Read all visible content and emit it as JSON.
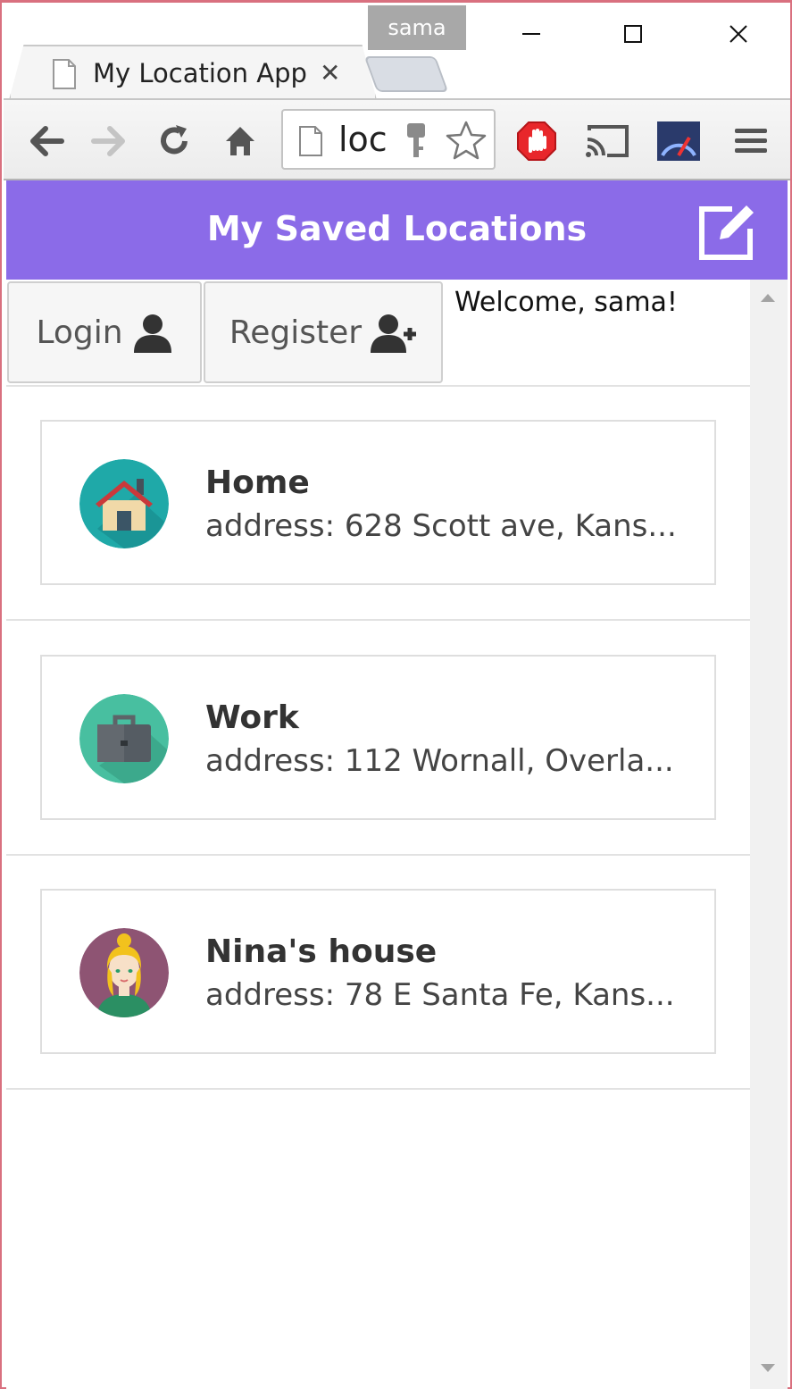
{
  "browser": {
    "profile_name": "sama",
    "tab_title": "My Location App",
    "tab_close": "✕",
    "omnibox_text": "loca"
  },
  "app": {
    "title": "My Saved Locations",
    "header_color": "#8b6be8"
  },
  "auth": {
    "login_label": "Login",
    "register_label": "Register",
    "welcome_text": "Welcome, sama!"
  },
  "locations": [
    {
      "name": "Home",
      "address": "address: 628 Scott ave, Kans...",
      "icon": "house-icon"
    },
    {
      "name": "Work",
      "address": "address: 112 Wornall, Overla...",
      "icon": "briefcase-icon"
    },
    {
      "name": "Nina's house",
      "address": "address: 78 E Santa Fe, Kans...",
      "icon": "person-avatar-icon"
    }
  ]
}
